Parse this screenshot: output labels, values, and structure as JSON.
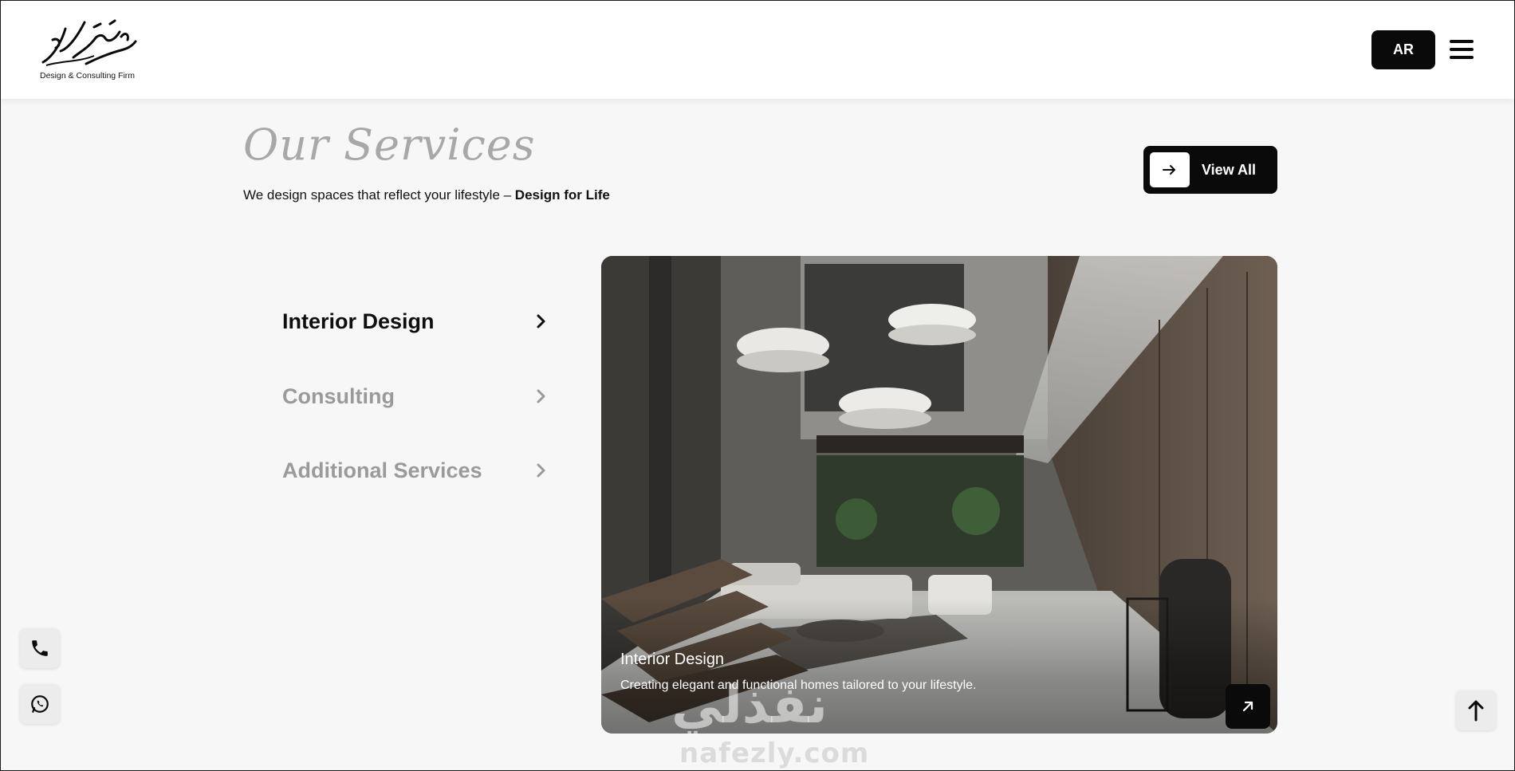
{
  "header": {
    "logo_tagline": "Design & Consulting Firm",
    "lang_button": "AR"
  },
  "section": {
    "title": "Our Services",
    "subtitle_prefix": "We design spaces that reflect your lifestyle – ",
    "subtitle_bold": "Design for Life",
    "view_all_label": "View All"
  },
  "services": [
    {
      "label": "Interior Design",
      "active": true
    },
    {
      "label": "Consulting",
      "active": false
    },
    {
      "label": "Additional Services",
      "active": false
    }
  ],
  "card": {
    "title": "Interior Design",
    "description": "Creating elegant and functional homes tailored to your lifestyle."
  },
  "watermark": {
    "arabic": "نفذلي",
    "latin": "nafezly.com"
  },
  "icons": {
    "menu": "hamburger-menu-icon",
    "view_all": "arrow-right-icon",
    "service_chevron": "chevron-right-icon",
    "card_link": "arrow-up-right-icon",
    "phone": "phone-icon",
    "whatsapp": "whatsapp-icon",
    "scroll_top": "arrow-up-icon"
  }
}
